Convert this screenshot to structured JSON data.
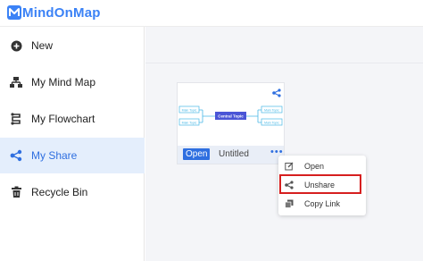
{
  "app": {
    "logo_text": "MindOnMap",
    "logo_mark": "M"
  },
  "sidebar": {
    "items": [
      {
        "label": "New",
        "icon": "plus-circle-icon"
      },
      {
        "label": "My Mind Map",
        "icon": "mind-map-icon"
      },
      {
        "label": "My Flowchart",
        "icon": "flowchart-icon"
      },
      {
        "label": "My Share",
        "icon": "share-icon",
        "active": true
      },
      {
        "label": "Recycle Bin",
        "icon": "trash-icon"
      }
    ]
  },
  "card": {
    "open_label": "Open",
    "title": "Untitled",
    "more": "•••",
    "preview": {
      "center_topic": "Central Topic",
      "left_topics": [
        "Main Topic",
        "Main Topic"
      ],
      "right_topics": [
        "Main Topic",
        "Main Topic"
      ]
    }
  },
  "context_menu": {
    "items": [
      {
        "label": "Open",
        "icon": "edit-icon"
      },
      {
        "label": "Unshare",
        "icon": "share-icon",
        "highlighted": true
      },
      {
        "label": "Copy Link",
        "icon": "copy-icon"
      }
    ]
  },
  "colors": {
    "accent": "#2f6fe0",
    "highlight": "#d61f1f",
    "active_bg": "#e4eefc"
  }
}
